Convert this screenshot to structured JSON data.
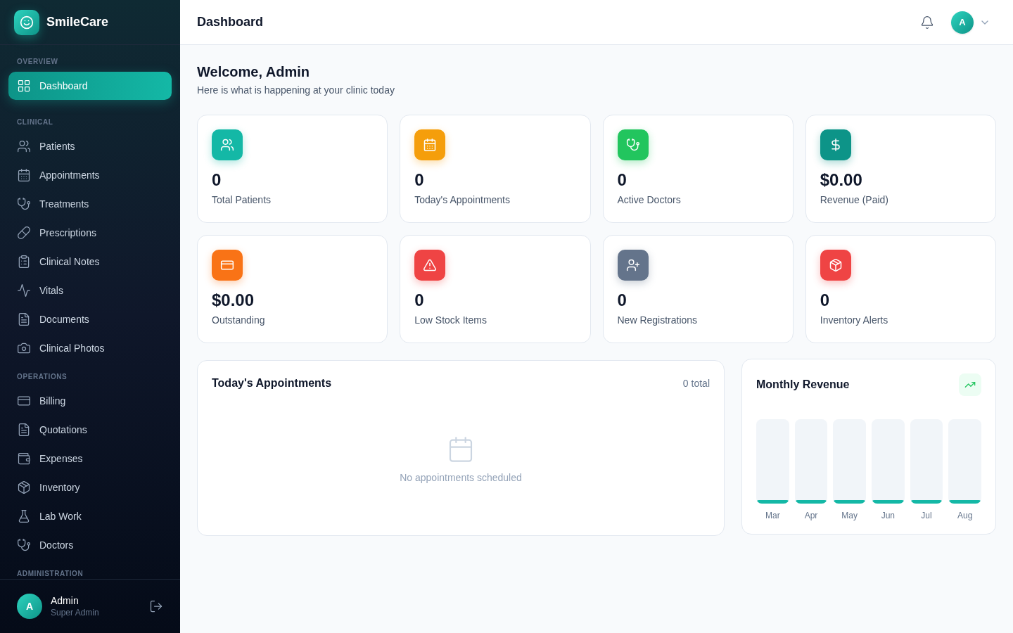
{
  "brand": {
    "name": "SmileCare"
  },
  "sidebar": {
    "sections": [
      {
        "title": "OVERVIEW",
        "items": [
          {
            "label": "Dashboard",
            "selected": true
          }
        ]
      },
      {
        "title": "CLINICAL",
        "items": [
          {
            "label": "Patients",
            "selected": false
          },
          {
            "label": "Appointments",
            "selected": false
          },
          {
            "label": "Treatments",
            "selected": false
          },
          {
            "label": "Prescriptions",
            "selected": false
          },
          {
            "label": "Clinical Notes",
            "selected": false
          },
          {
            "label": "Vitals",
            "selected": false
          },
          {
            "label": "Documents",
            "selected": false
          },
          {
            "label": "Clinical Photos",
            "selected": false
          }
        ]
      },
      {
        "title": "OPERATIONS",
        "items": [
          {
            "label": "Billing",
            "selected": false
          },
          {
            "label": "Quotations",
            "selected": false
          },
          {
            "label": "Expenses",
            "selected": false
          },
          {
            "label": "Inventory",
            "selected": false
          },
          {
            "label": "Lab Work",
            "selected": false
          },
          {
            "label": "Doctors",
            "selected": false
          }
        ]
      },
      {
        "title": "ADMINISTRATION"
      }
    ],
    "user": {
      "initial": "A",
      "name": "Admin",
      "role": "Super Admin"
    }
  },
  "header": {
    "title": "Dashboard",
    "avatar_initial": "A"
  },
  "welcome": {
    "title": "Welcome, Admin",
    "subtitle": "Here is what is happening at your clinic today"
  },
  "stats": [
    {
      "value": "0",
      "label": "Total Patients",
      "color": "#14b8a6"
    },
    {
      "value": "0",
      "label": "Today's Appointments",
      "color": "#f59e0b"
    },
    {
      "value": "0",
      "label": "Active Doctors",
      "color": "#22c55e"
    },
    {
      "value": "$0.00",
      "label": "Revenue (Paid)",
      "color": "#0d9488"
    },
    {
      "value": "$0.00",
      "label": "Outstanding",
      "color": "#f97316"
    },
    {
      "value": "0",
      "label": "Low Stock Items",
      "color": "#ef4444"
    },
    {
      "value": "0",
      "label": "New Registrations",
      "color": "#64748b"
    },
    {
      "value": "0",
      "label": "Inventory Alerts",
      "color": "#ef4444"
    }
  ],
  "appointments": {
    "title": "Today's Appointments",
    "count": "0 total",
    "empty_text": "No appointments scheduled"
  },
  "revenue": {
    "title": "Monthly Revenue",
    "months": [
      "Mar",
      "Apr",
      "May",
      "Jun",
      "Jul",
      "Aug"
    ]
  }
}
